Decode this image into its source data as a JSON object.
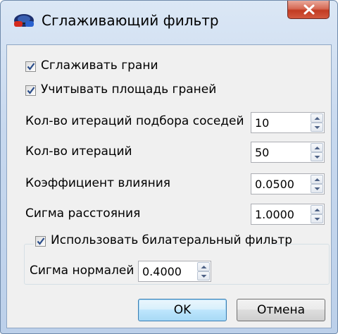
{
  "window": {
    "title": "Сглаживающий фильтр",
    "icon": "app-glasses-icon",
    "close_icon": "close-icon"
  },
  "options": {
    "smooth_edges": {
      "label": "Сглаживать грани",
      "checked": true
    },
    "face_area": {
      "label": "Учитывать площадь граней",
      "checked": true
    }
  },
  "fields": {
    "neighbor_iterations": {
      "label": "Кол-во итераций подбора соседей",
      "value": "10"
    },
    "iterations": {
      "label": "Кол-во итераций",
      "value": "50"
    },
    "influence": {
      "label": "Коэффициент влияния",
      "value": "0.0500"
    },
    "distance_sigma": {
      "label": "Сигма расстояния",
      "value": "1.0000"
    }
  },
  "bilateral": {
    "label": "Использовать билатеральный фильтр",
    "checked": true,
    "normal_sigma": {
      "label": "Сигма нормалей",
      "value": "0.4000"
    }
  },
  "buttons": {
    "ok": "OK",
    "cancel": "Отмена"
  },
  "colors": {
    "accent_checkmark": "#2a4d8a",
    "close_button": "#c23b22",
    "default_button_border": "#3c7fb1"
  }
}
